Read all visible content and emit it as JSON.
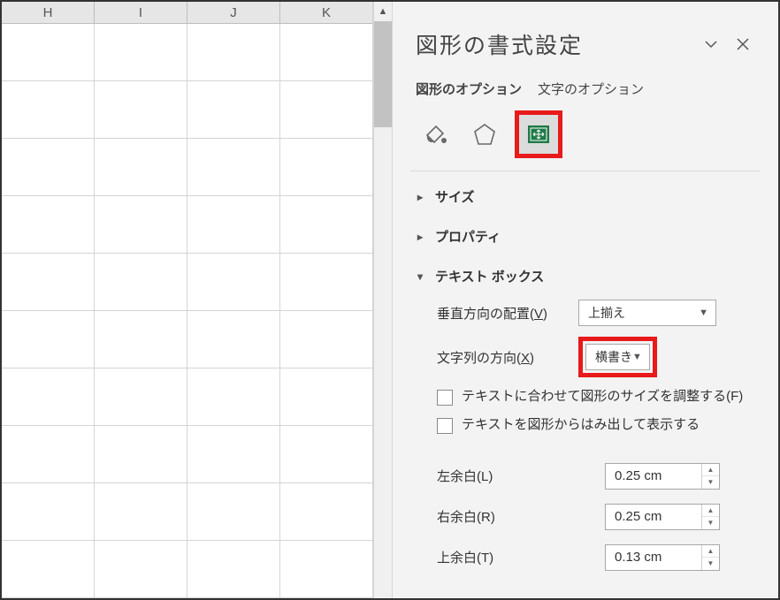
{
  "sheet": {
    "columns": [
      "H",
      "I",
      "J",
      "K"
    ]
  },
  "pane": {
    "title": "図形の書式設定",
    "tabs": {
      "shape_options": "図形のオプション",
      "text_options": "文字のオプション"
    },
    "icons": {
      "fill": "fill-line-icon",
      "effects": "effects-icon",
      "size": "size-properties-icon"
    },
    "sections": {
      "size_label": "サイズ",
      "properties_label": "プロパティ",
      "textbox_label": "テキスト ボックス"
    },
    "textbox": {
      "valign_label_prefix": "垂直方向の配置(",
      "valign_key": "V",
      "valign_label_suffix": ")",
      "valign_value": "上揃え",
      "direction_label_prefix": "文字列の方向(",
      "direction_key": "X",
      "direction_label_suffix": ")",
      "direction_value": "横書き",
      "autofit_label_prefix": "テキストに合わせて図形のサイズを調整する(",
      "autofit_key": "F",
      "autofit_label_suffix": ")",
      "overflow_label": "テキストを図形からはみ出して表示する",
      "left_margin_label_prefix": "左余白(",
      "left_margin_key": "L",
      "left_margin_label_suffix": ")",
      "left_margin_value": "0.25 cm",
      "right_margin_label_prefix": "右余白(",
      "right_margin_key": "R",
      "right_margin_label_suffix": ")",
      "right_margin_value": "0.25 cm",
      "top_margin_label_prefix": "上余白(",
      "top_margin_key": "T",
      "top_margin_label_suffix": ")",
      "top_margin_value": "0.13 cm"
    }
  }
}
